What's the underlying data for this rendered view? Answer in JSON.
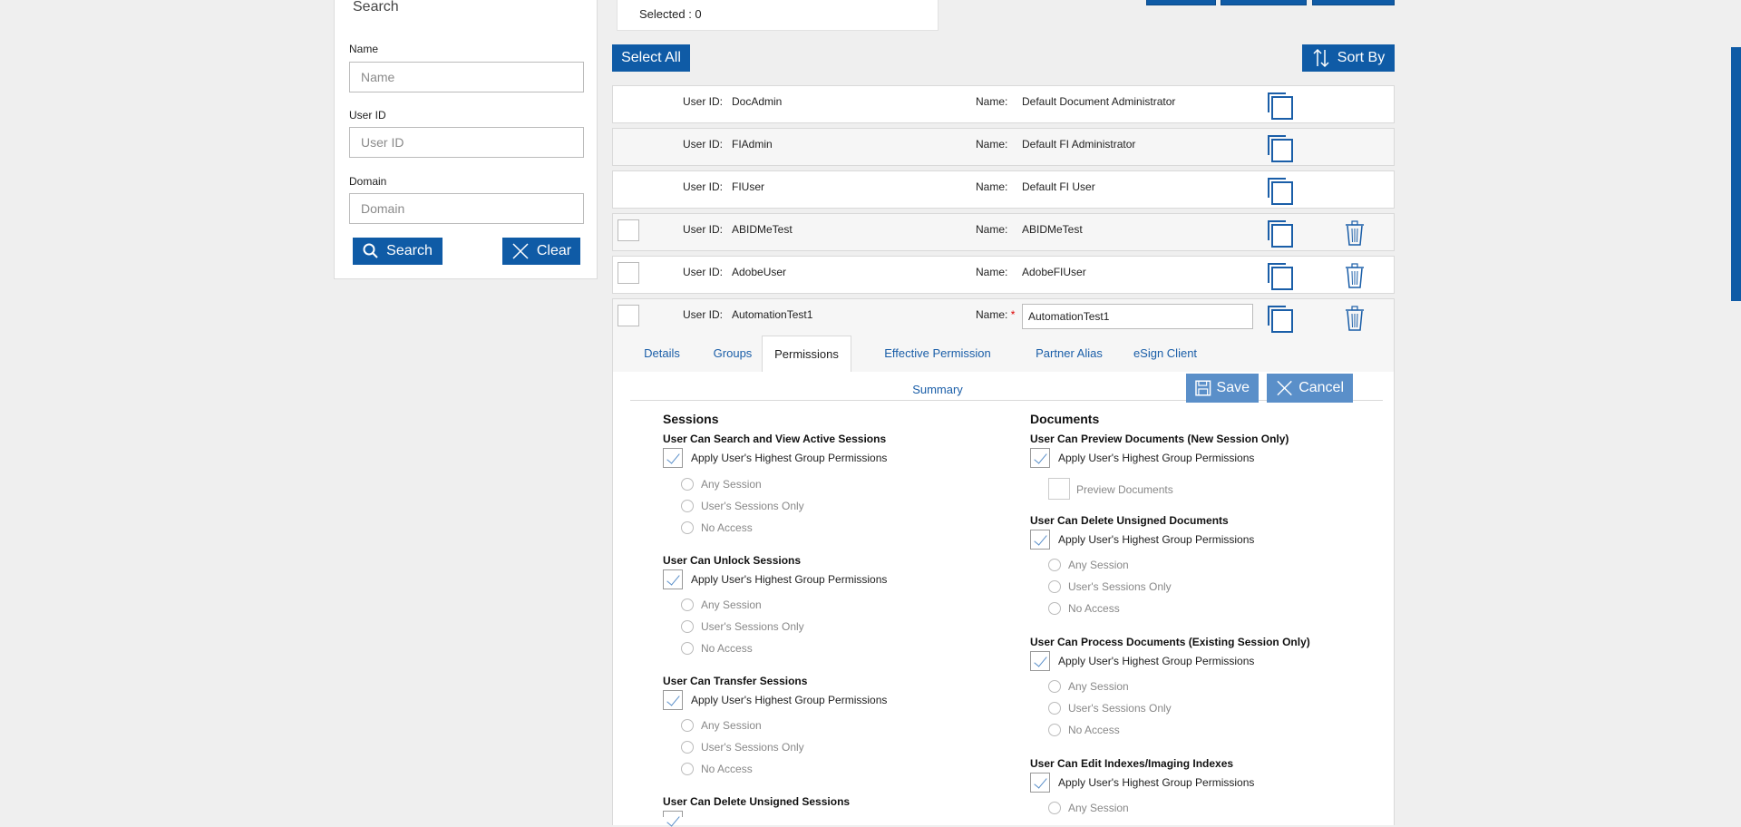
{
  "search_panel": {
    "title": "Search",
    "name_label": "Name",
    "name_placeholder": "Name",
    "userid_label": "User ID",
    "userid_placeholder": "User ID",
    "domain_label": "Domain",
    "domain_placeholder": "Domain",
    "search_button": "Search",
    "clear_button": "Clear"
  },
  "list": {
    "selected_text": "Selected : 0",
    "select_all": "Select All",
    "sort_by": "Sort By",
    "userid_label": "User ID:",
    "name_label": "Name:",
    "rows": [
      {
        "user_id": "DocAdmin",
        "name": "Default Document Administrator"
      },
      {
        "user_id": "FIAdmin",
        "name": "Default FI Administrator"
      },
      {
        "user_id": "FIUser",
        "name": "Default FI User"
      },
      {
        "user_id": "ABIDMeTest",
        "name": "ABIDMeTest"
      },
      {
        "user_id": "AdobeUser",
        "name": "AdobeFIUser"
      },
      {
        "user_id": "AutomationTest1",
        "name": "AutomationTest1"
      }
    ]
  },
  "editor": {
    "tabs": [
      "Details",
      "Groups",
      "Permissions",
      "Effective Permission Summary",
      "Partner Alias",
      "eSign Client"
    ],
    "active_tab": "Permissions",
    "save": "Save",
    "cancel": "Cancel",
    "apply_text": "Apply User's Highest Group Permissions",
    "options": [
      "Any Session",
      "User's Sessions Only",
      "No Access"
    ],
    "sessions": {
      "heading": "Sessions",
      "items": [
        "User Can Search and View Active Sessions",
        "User Can Unlock Sessions",
        "User Can Transfer Sessions",
        "User Can Delete Unsigned Sessions"
      ]
    },
    "documents": {
      "heading": "Documents",
      "items": [
        "User Can Preview Documents (New Session Only)",
        "User Can Delete Unsigned Documents",
        "User Can Process Documents (Existing Session Only)",
        "User Can Edit Indexes/Imaging Indexes"
      ],
      "preview_label": "Preview Documents"
    }
  }
}
